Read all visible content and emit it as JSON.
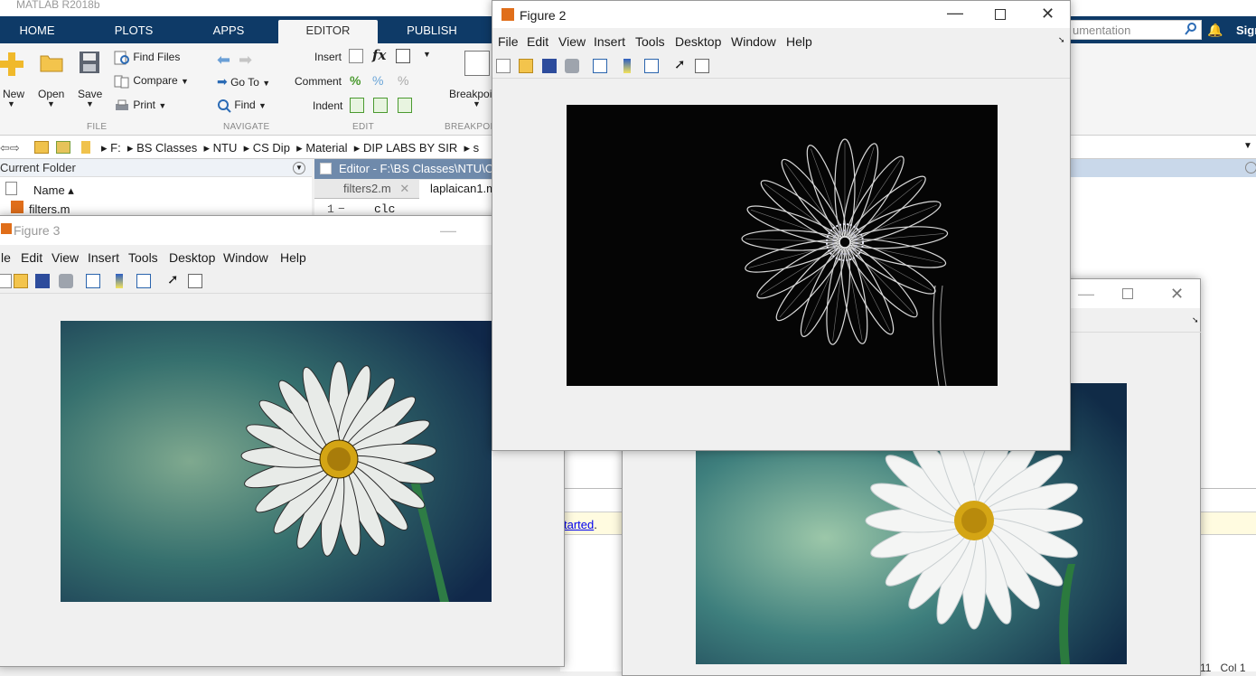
{
  "app": {
    "title": "MATLAB R2018b"
  },
  "tabs": [
    "HOME",
    "PLOTS",
    "APPS",
    "EDITOR",
    "PUBLISH"
  ],
  "ribbon": {
    "new": "New",
    "open": "Open",
    "save": "Save",
    "find_files": "Find Files",
    "compare": "Compare",
    "print": "Print",
    "go_to": "Go To",
    "find": "Find",
    "insert": "Insert",
    "comment": "Comment",
    "indent": "Indent",
    "breakpoints": "Breakpoi",
    "sections": {
      "file": "FILE",
      "navigate": "NAVIGATE",
      "edit": "EDIT",
      "breakpoints": "BREAKPOI"
    }
  },
  "search": {
    "value": "umentation",
    "signin": "Sigr"
  },
  "address": {
    "path": [
      "F:",
      "BS Classes",
      "NTU",
      "CS Dip",
      "Material",
      "DIP LABS BY SIR",
      "s"
    ]
  },
  "current_folder": {
    "title": "Current Folder",
    "col_name": "Name ▴",
    "files": [
      "filters.m"
    ]
  },
  "editor": {
    "title": "Editor - F:\\BS Classes\\NTU\\C",
    "tabs": [
      "filters2.m",
      "laplaican1.m"
    ],
    "line_no": "1",
    "line_marker": "−",
    "line_code": "clc"
  },
  "command_window": {
    "getting_started": "tarted",
    "getting_started_suffix": ".",
    "status_ln": "11",
    "status_col": "Col 1"
  },
  "figure3": {
    "title": "Figure 3",
    "menu": [
      "le",
      "Edit",
      "View",
      "Insert",
      "Tools",
      "Desktop",
      "Window",
      "Help"
    ]
  },
  "figure2": {
    "title": "Figure 2",
    "menu": [
      "File",
      "Edit",
      "View",
      "Insert",
      "Tools",
      "Desktop",
      "Window",
      "Help"
    ]
  },
  "icons": [
    "new-file-icon",
    "open-folder-icon",
    "save-disk-icon",
    "print-icon",
    "link-print-icon",
    "colorbar-icon",
    "legend-icon",
    "pointer-icon",
    "property-editor-icon",
    "matlab-logo-icon"
  ],
  "colors": {
    "tab_bar": "#0e3a67",
    "editor_header": "#6f8aab",
    "image_bg_dark": "#1a3a4a",
    "flower_center": "#d4a514"
  }
}
